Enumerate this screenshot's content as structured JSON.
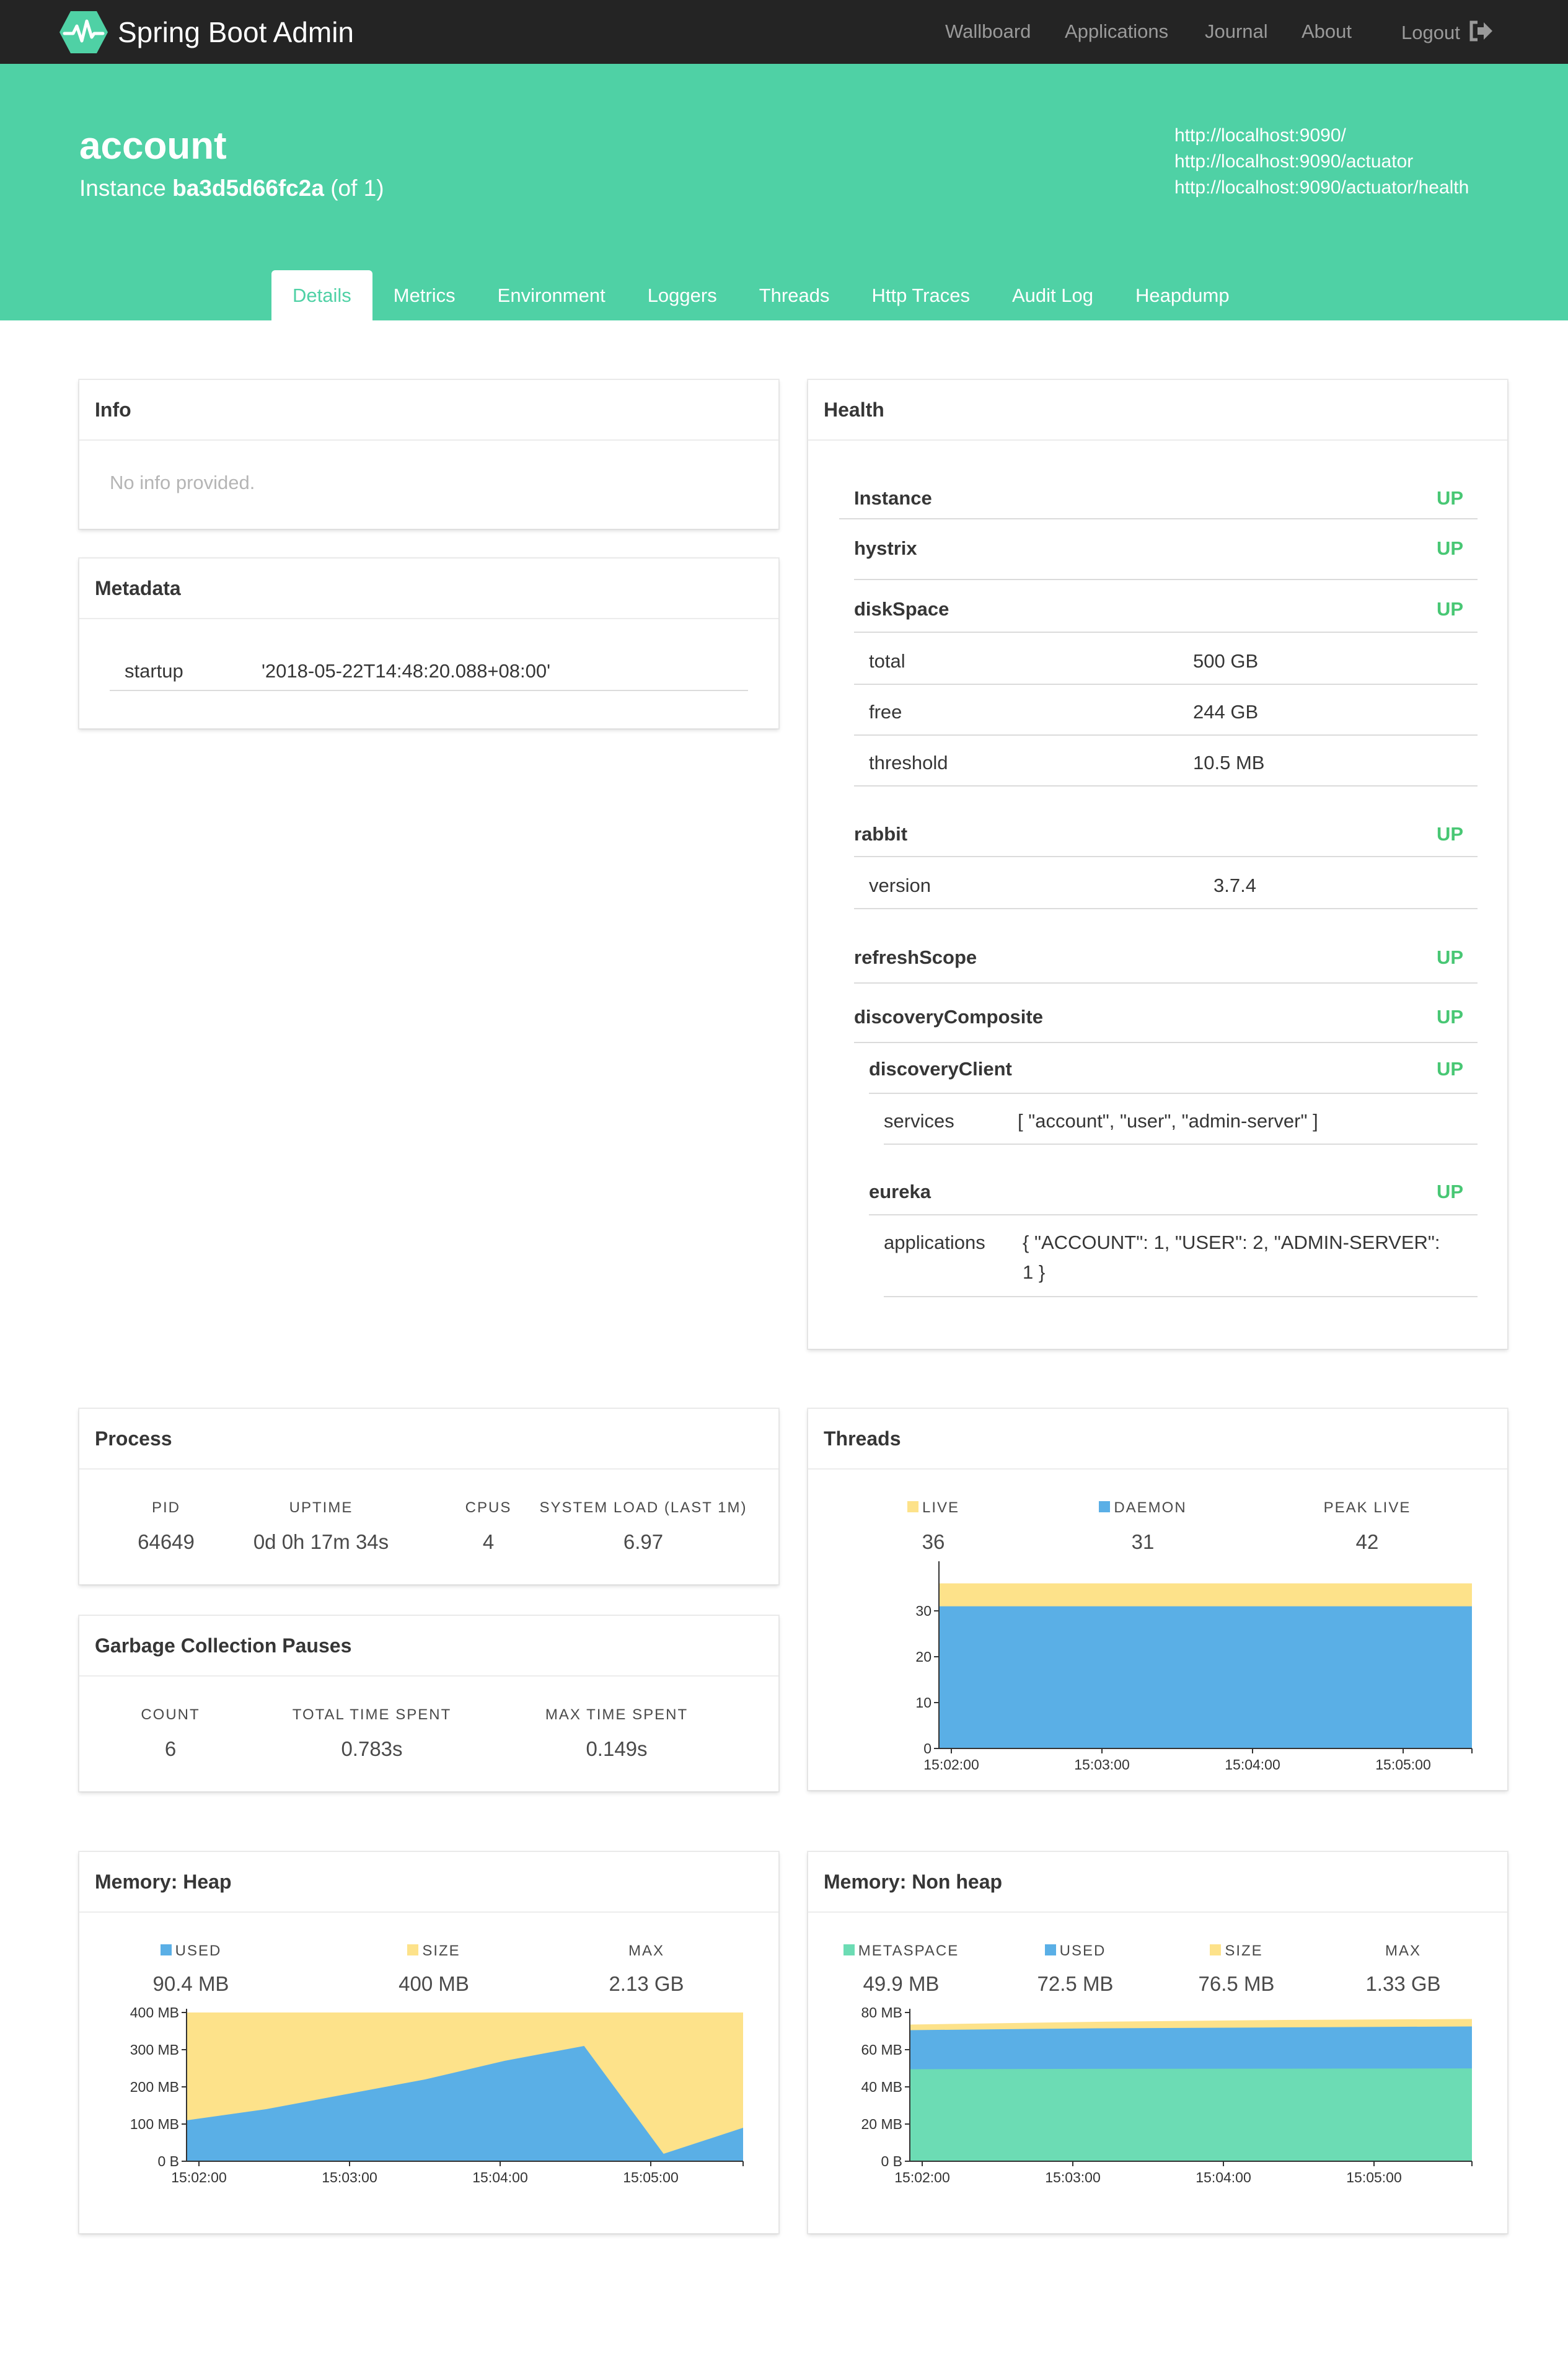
{
  "navbar": {
    "brand": "Spring Boot Admin",
    "links": [
      "Wallboard",
      "Applications",
      "Journal",
      "About"
    ],
    "logout": "Logout"
  },
  "hero": {
    "app_name": "account",
    "instance_prefix": "Instance",
    "instance_id": "ba3d5d66fc2a",
    "instance_suffix": "(of 1)",
    "urls": [
      "http://localhost:9090/",
      "http://localhost:9090/actuator",
      "http://localhost:9090/actuator/health"
    ]
  },
  "tabs": [
    "Details",
    "Metrics",
    "Environment",
    "Loggers",
    "Threads",
    "Http Traces",
    "Audit Log",
    "Heapdump"
  ],
  "info": {
    "title": "Info",
    "empty": "No info provided."
  },
  "metadata": {
    "title": "Metadata",
    "key": "startup",
    "value": "'2018-05-22T14:48:20.088+08:00'"
  },
  "health": {
    "title": "Health",
    "instance": "Instance",
    "status": "UP",
    "hystrix": "hystrix",
    "diskSpace": "diskSpace",
    "disk_rows": [
      {
        "k": "total",
        "v": "500 GB"
      },
      {
        "k": "free",
        "v": "244 GB"
      },
      {
        "k": "threshold",
        "v": "10.5 MB"
      }
    ],
    "rabbit": "rabbit",
    "rabbit_version_k": "version",
    "rabbit_version_v": "3.7.4",
    "refreshScope": "refreshScope",
    "discoveryComposite": "discoveryComposite",
    "discoveryClient": "discoveryClient",
    "services_k": "services",
    "services_v": "[ \"account\", \"user\", \"admin-server\" ]",
    "eureka": "eureka",
    "applications_k": "applications",
    "applications_v1": "{ \"ACCOUNT\": 1, \"USER\": 2, \"ADMIN-SERVER\":",
    "applications_v2": "1 }"
  },
  "process": {
    "title": "Process",
    "labels": [
      "PID",
      "UPTIME",
      "CPUS",
      "SYSTEM LOAD (LAST 1M)"
    ],
    "values": [
      "64649",
      "0d 0h 17m 34s",
      "4",
      "6.97"
    ]
  },
  "gc": {
    "title": "Garbage Collection Pauses",
    "labels": [
      "COUNT",
      "TOTAL TIME SPENT",
      "MAX TIME SPENT"
    ],
    "values": [
      "6",
      "0.783s",
      "0.149s"
    ]
  },
  "threads": {
    "title": "Threads",
    "labels": [
      "LIVE",
      "DAEMON",
      "PEAK LIVE"
    ],
    "values": [
      "36",
      "31",
      "42"
    ]
  },
  "heap": {
    "title": "Memory: Heap",
    "labels": [
      "USED",
      "SIZE",
      "MAX"
    ],
    "values": [
      "90.4 MB",
      "400 MB",
      "2.13 GB"
    ]
  },
  "nonheap": {
    "title": "Memory: Non heap",
    "labels": [
      "METASPACE",
      "USED",
      "SIZE",
      "MAX"
    ],
    "values": [
      "49.9 MB",
      "72.5 MB",
      "76.5 MB",
      "1.33 GB"
    ]
  },
  "colors": {
    "accent": "#4fd1a5",
    "up": "#48c774",
    "blue": "#5aafe6",
    "yellow": "#fde28a",
    "teal": "#6cdcb4"
  },
  "chart_data": [
    {
      "type": "area",
      "title": "Threads",
      "x_ticks": [
        "15:02:00",
        "15:03:00",
        "15:04:00",
        "15:05:00"
      ],
      "y_ticks": [
        "0",
        "10",
        "20",
        "30"
      ],
      "ylim": [
        0,
        40
      ],
      "series": [
        {
          "name": "DAEMON",
          "color": "#5aafe6",
          "values": [
            31,
            31,
            31,
            31,
            31
          ]
        },
        {
          "name": "LIVE",
          "color": "#fde28a",
          "values": [
            36,
            36,
            36,
            36,
            36
          ]
        }
      ]
    },
    {
      "type": "area",
      "title": "Memory: Heap",
      "x_ticks": [
        "15:02:00",
        "15:03:00",
        "15:04:00",
        "15:05:00"
      ],
      "y_ticks": [
        "0 B",
        "100 MB",
        "200 MB",
        "300 MB",
        "400 MB"
      ],
      "ylim": [
        0,
        400
      ],
      "series": [
        {
          "name": "USED",
          "color": "#5aafe6",
          "values": [
            110,
            140,
            180,
            220,
            270,
            310,
            20,
            90
          ]
        },
        {
          "name": "SIZE",
          "color": "#fde28a",
          "values": [
            400,
            400,
            400,
            400,
            400,
            400,
            400,
            400
          ]
        }
      ]
    },
    {
      "type": "area",
      "title": "Memory: Non heap",
      "x_ticks": [
        "15:02:00",
        "15:03:00",
        "15:04:00",
        "15:05:00"
      ],
      "y_ticks": [
        "0 B",
        "20 MB",
        "40 MB",
        "60 MB",
        "80 MB"
      ],
      "ylim": [
        0,
        80
      ],
      "series": [
        {
          "name": "METASPACE",
          "color": "#6cdcb4",
          "values": [
            49.5,
            49.7,
            49.8,
            49.9
          ]
        },
        {
          "name": "USED",
          "color": "#5aafe6",
          "values": [
            70.5,
            71.5,
            72,
            72.5
          ]
        },
        {
          "name": "SIZE",
          "color": "#fde28a",
          "values": [
            73.5,
            75,
            76,
            76.5
          ]
        }
      ]
    }
  ]
}
